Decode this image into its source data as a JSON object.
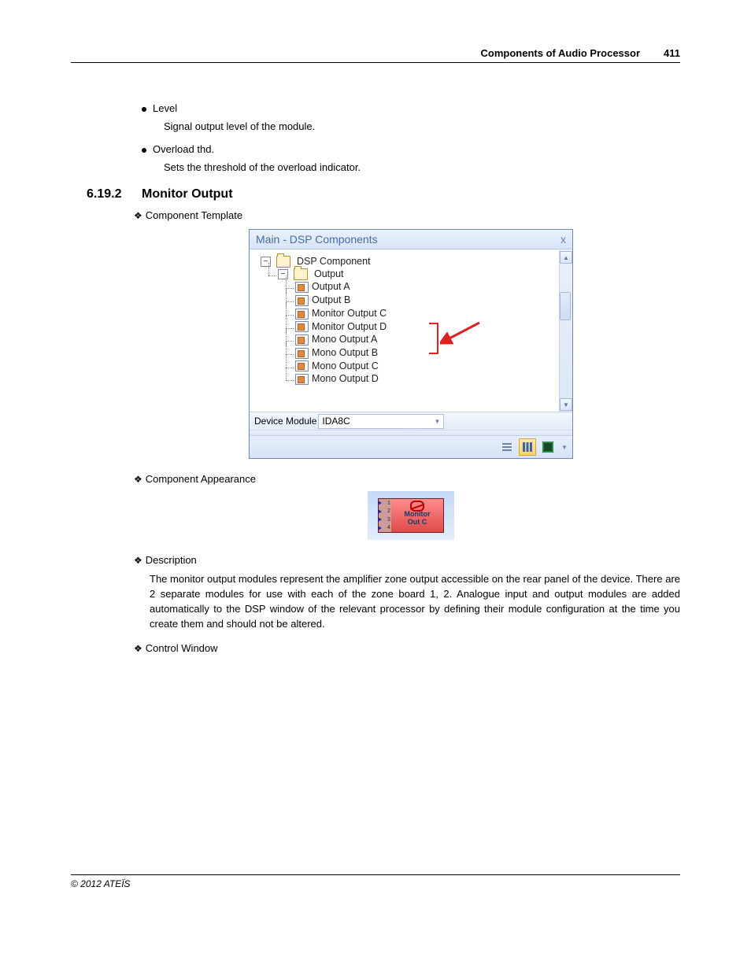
{
  "header": {
    "title": "Components of Audio Processor",
    "page": "411"
  },
  "bullets": [
    {
      "label": "Level",
      "desc": "Signal output level of the module."
    },
    {
      "label": "Overload thd.",
      "desc": "Sets the threshold of the  overload indicator."
    }
  ],
  "section": {
    "number": "6.19.2",
    "title": "Monitor Output"
  },
  "headings": {
    "template": "Component Template",
    "appearance": "Component Appearance",
    "description": "Description",
    "control": "Control Window"
  },
  "description_text": "The monitor output modules represent the amplifier zone output accessible on the rear panel of the device. There are 2 separate modules for use with each of the zone board 1, 2. Analogue input and output modules are added automatically to the DSP window of the relevant processor by defining their module configuration at the time you create them and should not be altered.",
  "panel": {
    "title": "Main - DSP Components",
    "close": "x",
    "tree": {
      "root": "DSP Component",
      "group": "Output",
      "items": [
        "Output A",
        "Output B",
        "Monitor Output C",
        "Monitor Output D",
        "Mono Output A",
        "Mono Output B",
        "Mono Output C",
        "Mono Output D"
      ]
    },
    "device_label": "Device Module",
    "device_value": "IDA8C"
  },
  "component": {
    "label_line1": "Monitor",
    "label_line2": "Out C",
    "ports": [
      "1",
      "2",
      "3",
      "4"
    ]
  },
  "footer": "© 2012 ATEÏS"
}
